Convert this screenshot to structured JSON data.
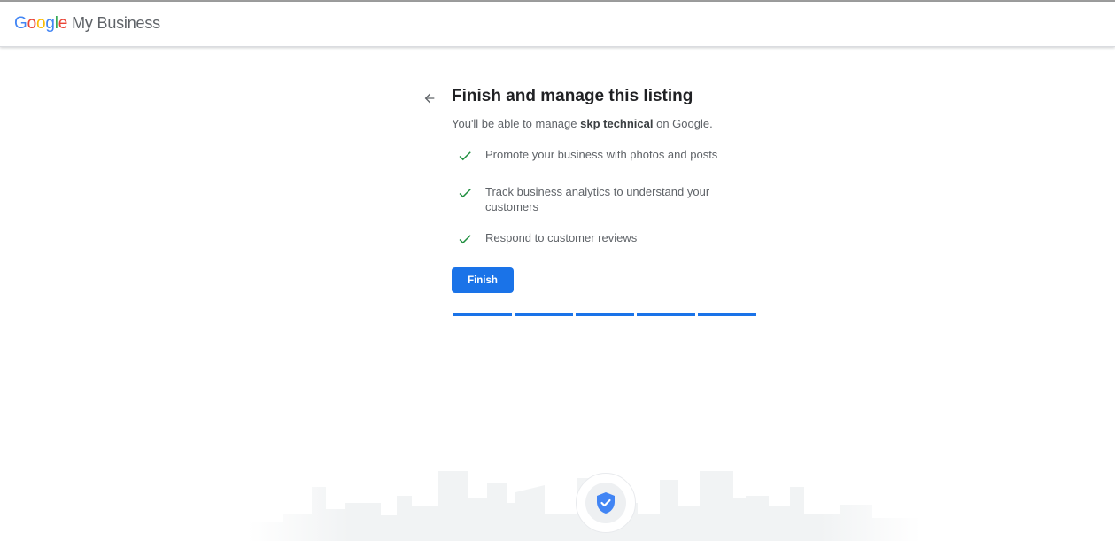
{
  "header": {
    "brand": {
      "letters": [
        {
          "ch": "G",
          "color": "#4285F4"
        },
        {
          "ch": "o",
          "color": "#EA4335"
        },
        {
          "ch": "o",
          "color": "#FBBC05"
        },
        {
          "ch": "g",
          "color": "#4285F4"
        },
        {
          "ch": "l",
          "color": "#34A853"
        },
        {
          "ch": "e",
          "color": "#EA4335"
        }
      ],
      "product": "My Business"
    }
  },
  "main": {
    "back_icon": "arrow-back-icon",
    "title": "Finish and manage this listing",
    "subtitle_pre": "You'll be able to manage ",
    "business_name": "skp technical",
    "subtitle_post": " on Google.",
    "benefits": [
      {
        "icon": "check-icon",
        "text": "Promote your business with photos and posts"
      },
      {
        "icon": "check-icon",
        "text": "Track business analytics to understand your customers"
      },
      {
        "icon": "check-icon",
        "text": "Respond to customer reviews"
      }
    ],
    "finish_label": "Finish",
    "progress": {
      "steps": 5,
      "completed": 5
    }
  },
  "footer": {
    "illustration": "city-skyline",
    "badge_icon": "verified-shield-icon"
  },
  "colors": {
    "accent": "#1a73e8",
    "check": "#1e8e3e",
    "text_primary": "#202124",
    "text_secondary": "#5f6368"
  }
}
